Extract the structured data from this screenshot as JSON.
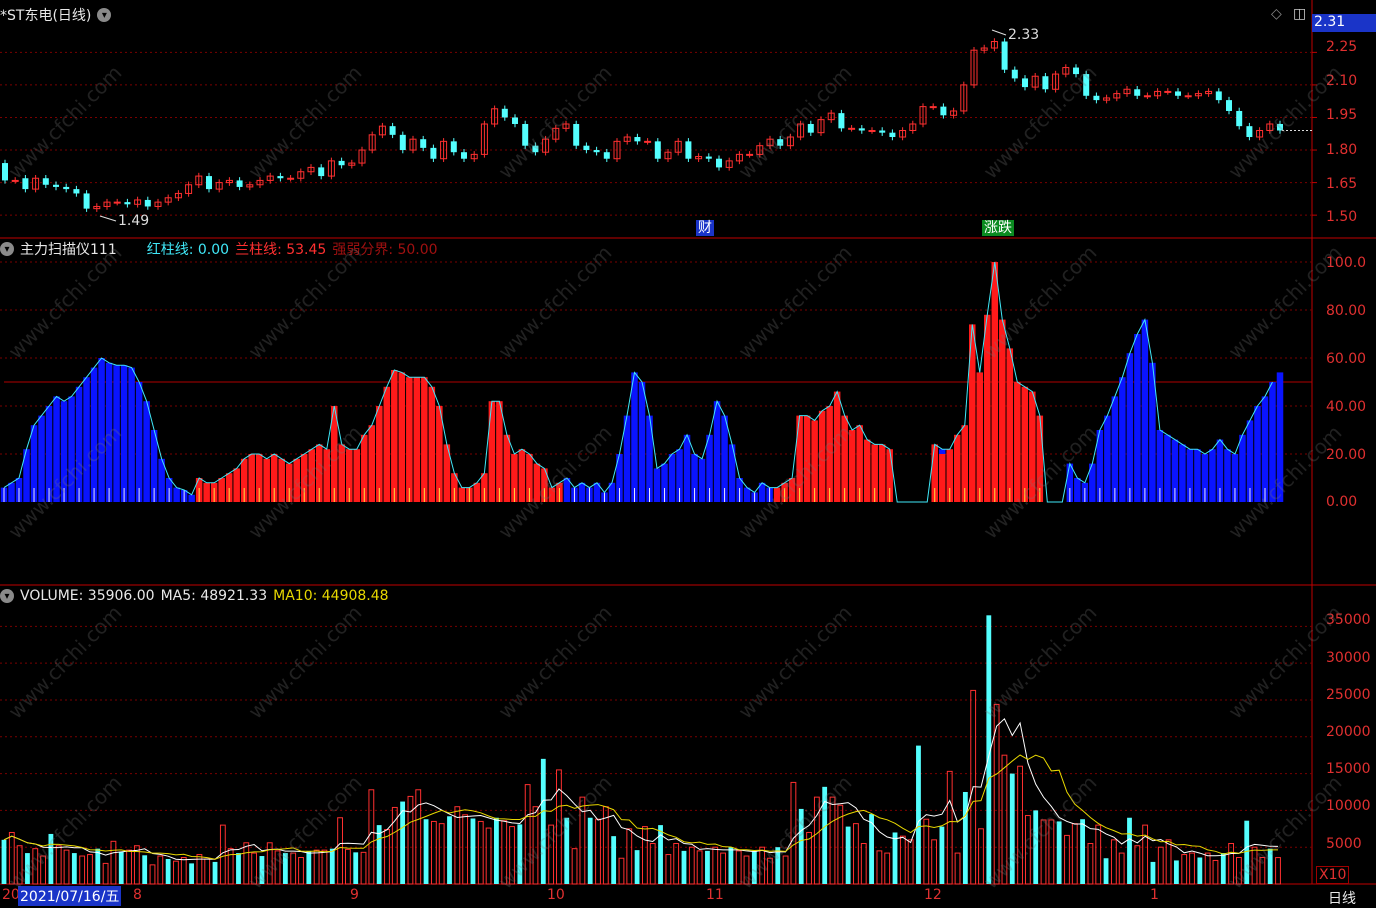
{
  "stock": {
    "title": "*ST东电(日线)"
  },
  "price_panel": {
    "high_marker": "2.33",
    "low_marker": "1.49",
    "event_cai": "财",
    "event_die": "涨跌",
    "y_ticks": [
      "2.25",
      "2.10",
      "1.95",
      "1.80",
      "1.65",
      "1.50"
    ],
    "current_price": "2.31"
  },
  "indicator_panel": {
    "name": "主力扫描仪111",
    "red_label": "红柱线: 0.00",
    "blue_label": "兰柱线: 53.45",
    "boundary_label": "强弱分界: 50.00",
    "y_ticks": [
      "100.0",
      "80.00",
      "60.00",
      "40.00",
      "20.00",
      "0.00"
    ]
  },
  "volume_panel": {
    "volume_label": "VOLUME: 35906.00",
    "ma5_label": "MA5: 48921.33",
    "ma10_label": "MA10: 44908.48",
    "y_ticks": [
      "35000",
      "30000",
      "25000",
      "20000",
      "15000",
      "10000",
      "5000"
    ],
    "unit": "X10"
  },
  "x_axis": {
    "selected_date": "2021/07/16/五",
    "start": "20",
    "months": [
      "8",
      "9",
      "10",
      "11",
      "12",
      "1"
    ],
    "period": "日线"
  },
  "watermark": "www.cfchi.com",
  "colors": {
    "up": "#ff3030",
    "down": "#54ffff",
    "blue_bar": "#0a14ff",
    "grid": "#7a0000",
    "ma5": "#ffffff",
    "ma10": "#e8d800"
  },
  "chart_data": [
    {
      "type": "candlestick",
      "title": "*ST东电(日线)",
      "ylim": [
        1.45,
        2.33
      ],
      "open": [
        1.74,
        1.66,
        1.67,
        1.62,
        1.67,
        1.64,
        1.63,
        1.62,
        1.6,
        1.53,
        1.54,
        1.56,
        1.56,
        1.55,
        1.57,
        1.54,
        1.56,
        1.58,
        1.6,
        1.64,
        1.68,
        1.62,
        1.65,
        1.66,
        1.63,
        1.64,
        1.66,
        1.68,
        1.67,
        1.67,
        1.7,
        1.72,
        1.68,
        1.75,
        1.73,
        1.74,
        1.8,
        1.87,
        1.91,
        1.87,
        1.8,
        1.85,
        1.81,
        1.76,
        1.84,
        1.79,
        1.76,
        1.78,
        1.92,
        1.99,
        1.95,
        1.92,
        1.82,
        1.79,
        1.85,
        1.9,
        1.92,
        1.82,
        1.8,
        1.79,
        1.76,
        1.84,
        1.86,
        1.84,
        1.84,
        1.76,
        1.79,
        1.84,
        1.76,
        1.77,
        1.76,
        1.72,
        1.75,
        1.78,
        1.78,
        1.82,
        1.85,
        1.82,
        1.86,
        1.92,
        1.88,
        1.94,
        1.97,
        1.9,
        1.9,
        1.89,
        1.89,
        1.88,
        1.86,
        1.89,
        1.92,
        2.0,
        2.0,
        1.96,
        1.98,
        2.1,
        2.26,
        2.27,
        2.3,
        2.17,
        2.13,
        2.09,
        2.14,
        2.08,
        2.15,
        2.18,
        2.15,
        2.05,
        2.03,
        2.04,
        2.06,
        2.08,
        2.05,
        2.05,
        2.07,
        2.07,
        2.05,
        2.05,
        2.06,
        2.07,
        2.03,
        1.98,
        1.91,
        1.86,
        1.89,
        1.92
      ],
      "close": [
        1.66,
        1.66,
        1.62,
        1.67,
        1.64,
        1.63,
        1.62,
        1.6,
        1.53,
        1.54,
        1.56,
        1.56,
        1.55,
        1.57,
        1.54,
        1.56,
        1.58,
        1.6,
        1.64,
        1.68,
        1.62,
        1.65,
        1.66,
        1.63,
        1.64,
        1.66,
        1.68,
        1.67,
        1.67,
        1.7,
        1.72,
        1.68,
        1.75,
        1.73,
        1.74,
        1.8,
        1.87,
        1.91,
        1.87,
        1.8,
        1.85,
        1.81,
        1.76,
        1.84,
        1.79,
        1.76,
        1.78,
        1.92,
        1.99,
        1.95,
        1.92,
        1.82,
        1.79,
        1.85,
        1.9,
        1.92,
        1.82,
        1.8,
        1.79,
        1.76,
        1.84,
        1.86,
        1.84,
        1.84,
        1.76,
        1.79,
        1.84,
        1.76,
        1.77,
        1.76,
        1.72,
        1.75,
        1.78,
        1.78,
        1.82,
        1.85,
        1.82,
        1.86,
        1.92,
        1.88,
        1.94,
        1.97,
        1.9,
        1.9,
        1.89,
        1.89,
        1.88,
        1.86,
        1.89,
        1.92,
        2.0,
        2.0,
        1.96,
        1.98,
        2.1,
        2.26,
        2.27,
        2.3,
        2.17,
        2.13,
        2.09,
        2.14,
        2.08,
        2.15,
        2.18,
        2.15,
        2.05,
        2.03,
        2.04,
        2.06,
        2.08,
        2.05,
        2.05,
        2.07,
        2.07,
        2.05,
        2.05,
        2.06,
        2.07,
        2.03,
        1.98,
        1.91,
        1.86,
        1.89,
        1.92,
        1.89
      ],
      "high_label": "2.33",
      "low_label": "1.49"
    },
    {
      "type": "bar",
      "title": "主力扫描仪111",
      "ylim": [
        0,
        100
      ],
      "threshold": 50,
      "blue_values": [
        6,
        8,
        10,
        22,
        32,
        36,
        40,
        44,
        42,
        44,
        48,
        52,
        56,
        60,
        58,
        57,
        57,
        56,
        50,
        42,
        30,
        18,
        10,
        6,
        5,
        3,
        0,
        0,
        0,
        0,
        0,
        0,
        0,
        0,
        0,
        0,
        0,
        0,
        0,
        0,
        0,
        0,
        0,
        0,
        0,
        0,
        0,
        0,
        0,
        0,
        0,
        0,
        0,
        0,
        0,
        0,
        0,
        0,
        0,
        0,
        0,
        0,
        0,
        0,
        0,
        0,
        0,
        0,
        0,
        0,
        0,
        0,
        0,
        0,
        0,
        10,
        6,
        8,
        6,
        8,
        4,
        8,
        20,
        36,
        54,
        50,
        36,
        14,
        16,
        20,
        22,
        28,
        20,
        18,
        28,
        42,
        36,
        24,
        10,
        6,
        4,
        8,
        6,
        0,
        0,
        0,
        0,
        0,
        0,
        0,
        0,
        0,
        0,
        0,
        0,
        0,
        0,
        0,
        0,
        0,
        0,
        0,
        0,
        0,
        0,
        22,
        10,
        8,
        0,
        0,
        0,
        0,
        0,
        0,
        0,
        0,
        0,
        0,
        0,
        0,
        0,
        0,
        16,
        10,
        8,
        16,
        30,
        36,
        44,
        52,
        62,
        70,
        76,
        58,
        30,
        28,
        26,
        24,
        22,
        22,
        20,
        22,
        26,
        22,
        20,
        28,
        34,
        40,
        44,
        50,
        54
      ],
      "red_values": [
        0,
        0,
        0,
        0,
        0,
        0,
        0,
        0,
        0,
        0,
        0,
        0,
        0,
        0,
        0,
        0,
        0,
        0,
        0,
        0,
        0,
        0,
        0,
        0,
        0,
        0,
        10,
        8,
        8,
        10,
        12,
        14,
        18,
        20,
        20,
        18,
        20,
        18,
        16,
        18,
        20,
        22,
        24,
        22,
        40,
        24,
        22,
        22,
        28,
        32,
        40,
        48,
        55,
        54,
        52,
        52,
        52,
        48,
        40,
        24,
        12,
        6,
        6,
        8,
        12,
        42,
        42,
        28,
        20,
        22,
        20,
        16,
        14,
        6,
        8,
        0,
        0,
        0,
        0,
        0,
        0,
        0,
        0,
        0,
        0,
        0,
        0,
        0,
        0,
        0,
        0,
        0,
        0,
        0,
        0,
        0,
        0,
        0,
        0,
        0,
        0,
        0,
        0,
        6,
        8,
        10,
        36,
        36,
        34,
        38,
        40,
        46,
        36,
        30,
        32,
        26,
        24,
        24,
        22,
        0,
        0,
        0,
        0,
        0,
        24,
        20,
        22,
        28,
        32,
        74,
        54,
        78,
        100,
        76,
        64,
        50,
        48,
        46,
        36,
        0,
        0,
        0,
        0,
        0,
        0,
        0,
        0,
        0,
        0,
        0,
        0,
        0,
        0,
        0,
        0,
        0,
        0,
        0,
        0,
        0,
        0,
        0,
        0,
        0,
        0,
        0,
        0,
        0,
        0,
        0
      ]
    },
    {
      "type": "bar",
      "title": "VOLUME",
      "ylim": [
        0,
        36000
      ],
      "values": [
        6000,
        7000,
        5200,
        4200,
        4800,
        3800,
        6800,
        5200,
        4600,
        4200,
        3800,
        4000,
        4800,
        2800,
        5800,
        4400,
        4600,
        5200,
        3900,
        2600,
        3800,
        3400,
        3100,
        3600,
        2800,
        4000,
        3400,
        3000,
        8000,
        4800,
        4200,
        5600,
        4200,
        3800,
        5600,
        4500,
        4200,
        4200,
        3600,
        4500,
        4600,
        4600,
        4800,
        9000,
        4700,
        4300,
        4300,
        12800,
        8000,
        7400,
        10400,
        11200,
        11900,
        12800,
        8800,
        8500,
        8200,
        9200,
        10500,
        9400,
        8900,
        8500,
        7600,
        9000,
        8600,
        7800,
        8100,
        13500,
        10500,
        17000,
        8000,
        15500,
        9000,
        4800,
        11800,
        9000,
        8800,
        10500,
        6500,
        3500,
        7500,
        4600,
        7800,
        5500,
        8000,
        4000,
        5500,
        4500,
        5000,
        4500,
        4500,
        5000,
        4200,
        5000,
        4500,
        3800,
        4500,
        5000,
        3500,
        5000,
        3800,
        13800,
        10200,
        7000,
        11800,
        13200,
        11800,
        10700,
        7800,
        8200,
        5500,
        9500,
        4500,
        4200,
        7000,
        6500,
        6000,
        18800,
        8800,
        6000,
        7800,
        15300,
        4200,
        12500,
        26300,
        7500,
        36500,
        24400,
        17500,
        15000,
        16000,
        9300,
        10000,
        8700,
        8700,
        8500,
        6600,
        8200,
        8800,
        5500,
        8000,
        3500,
        6000,
        4200,
        9000,
        5200,
        8000,
        3000,
        5000,
        6000,
        3200,
        4000,
        4200,
        3600,
        4200,
        3200,
        4200,
        5500,
        3600,
        8600,
        5000,
        3600,
        4800,
        3590
      ],
      "ma5_label": "MA5: 48921.33",
      "ma10_label": "MA10: 44908.48"
    }
  ]
}
